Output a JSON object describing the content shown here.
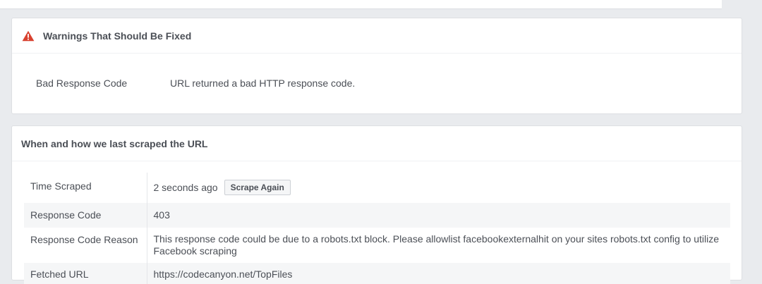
{
  "warnings_panel": {
    "title": "Warnings That Should Be Fixed",
    "icon": "warning-icon",
    "icon_color": "#d8412f",
    "rows": [
      {
        "label": "Bad Response Code",
        "value": "URL returned a bad HTTP response code."
      }
    ]
  },
  "scrape_panel": {
    "title": "When and how we last scraped the URL",
    "rows": [
      {
        "label": "Time Scraped",
        "value": "2 seconds ago",
        "button": "Scrape Again"
      },
      {
        "label": "Response Code",
        "value": "403"
      },
      {
        "label": "Response Code Reason",
        "value": "This response code could be due to a robots.txt block. Please allowlist facebookexternalhit on your sites robots.txt config to utilize Facebook scraping"
      },
      {
        "label": "Fetched URL",
        "value": "https://codecanyon.net/TopFiles"
      }
    ]
  }
}
